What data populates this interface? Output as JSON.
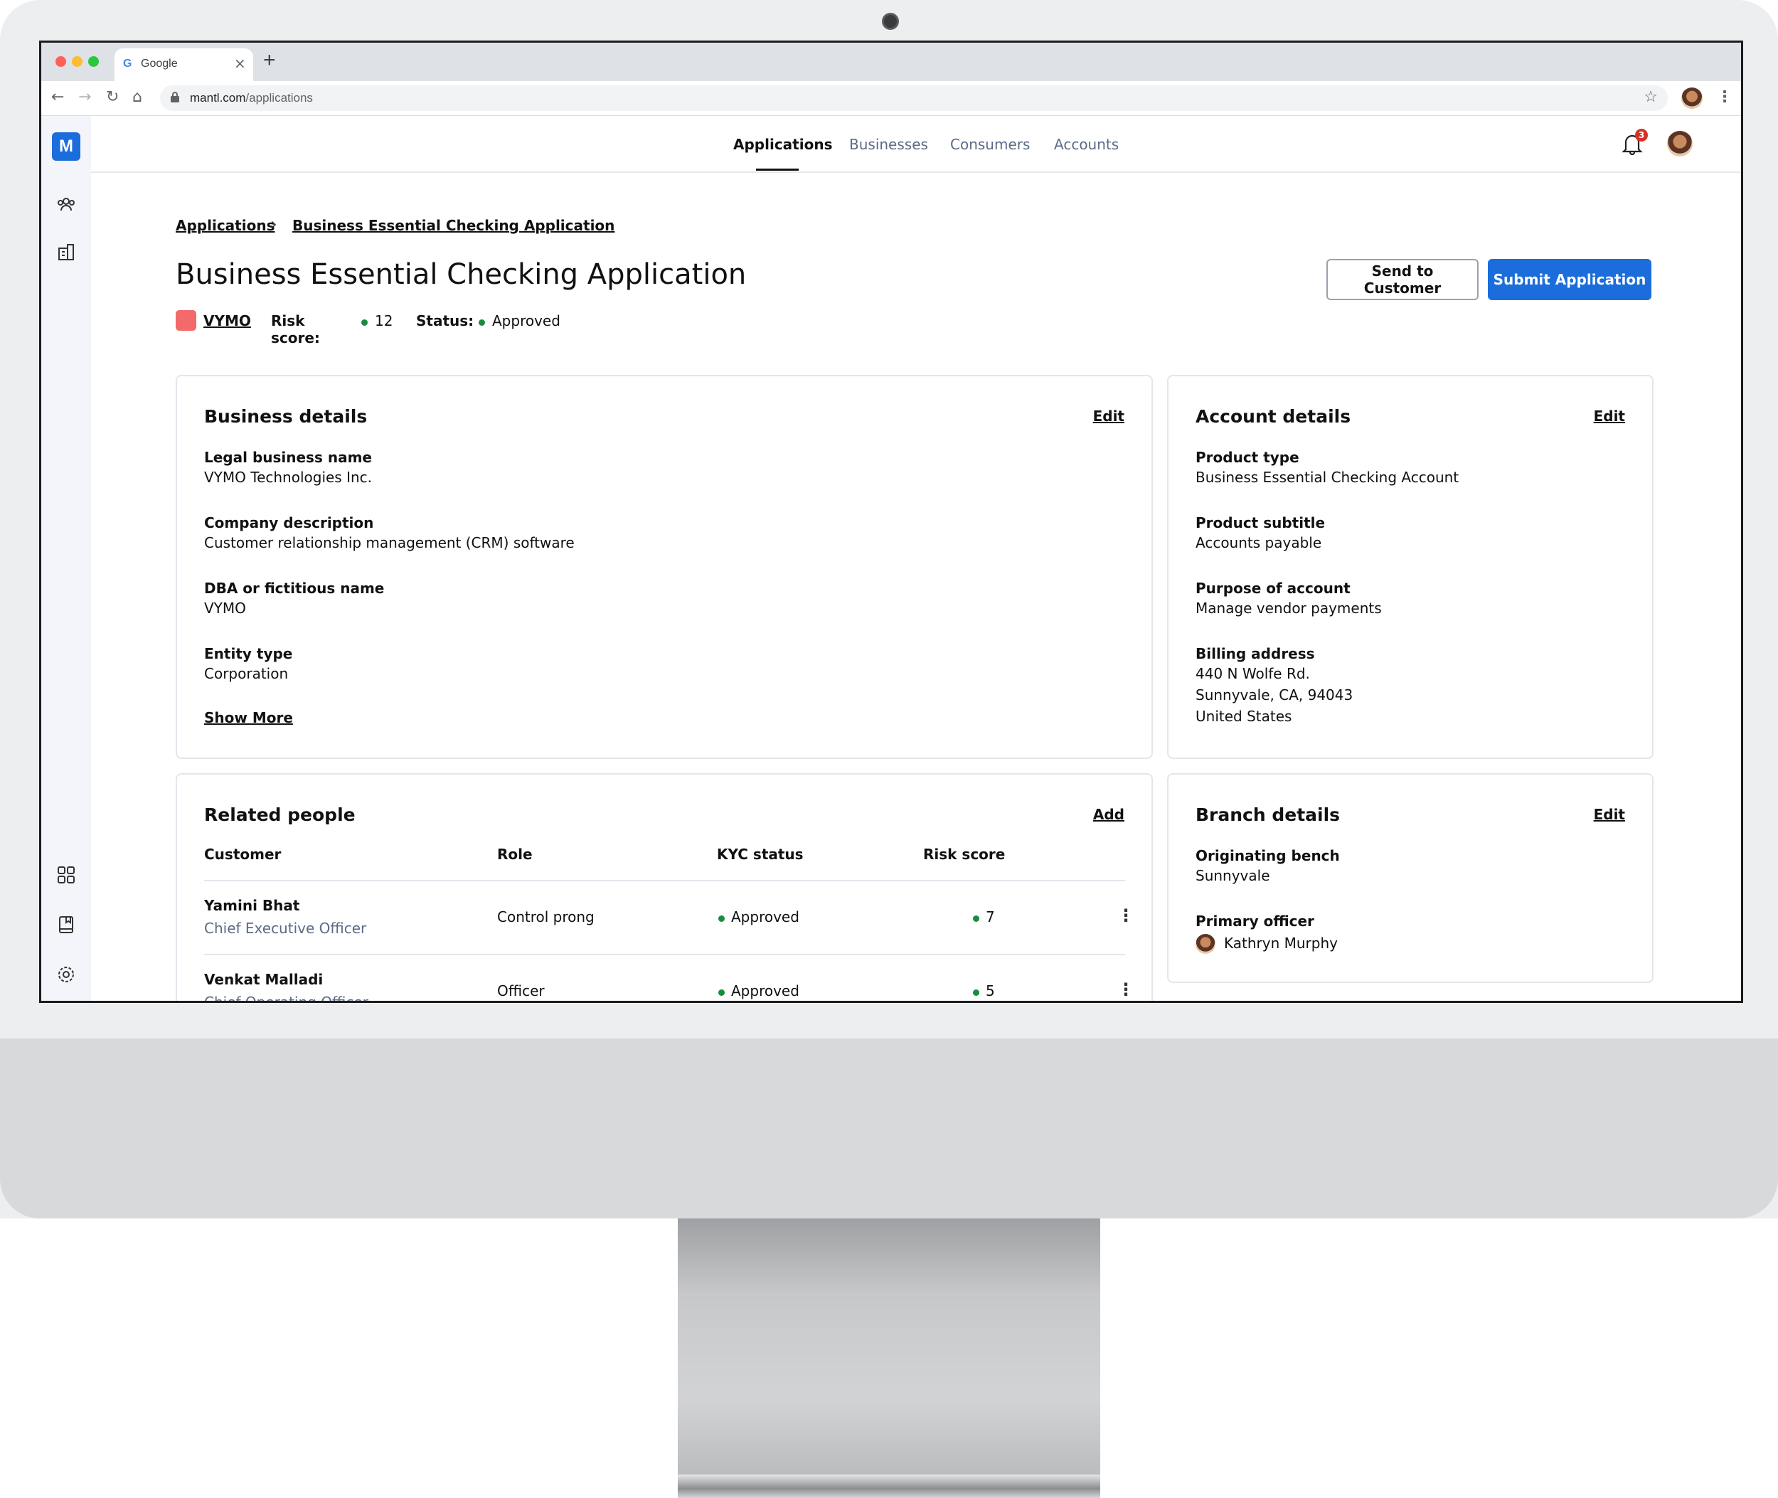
{
  "browser": {
    "tab_title": "Google",
    "tab_icon": "G",
    "url_host": "mantl.com",
    "url_path": "/applications"
  },
  "app": {
    "logo_letter": "M",
    "nav": [
      "Applications",
      "Businesses",
      "Consumers",
      "Accounts"
    ],
    "active_nav": "Applications",
    "notifications_count": "3"
  },
  "breadcrumb": {
    "root": "Applications",
    "current": "Business Essential Checking Application"
  },
  "page": {
    "title": "Business Essential Checking Application",
    "send_button": "Send to Customer",
    "submit_button": "Submit Application",
    "business_name": "VYMO",
    "risk_label": "Risk score:",
    "risk_value": "12",
    "status_label": "Status:",
    "status_value": "Approved",
    "status_color": "#1a8c3e",
    "accent_color": "#1a6ddb"
  },
  "business_details": {
    "title": "Business details",
    "edit": "Edit",
    "fields": [
      {
        "label": "Legal business name",
        "value": "VYMO Technologies Inc."
      },
      {
        "label": "Company description",
        "value": "Customer relationship management (CRM) software"
      },
      {
        "label": "DBA or fictitious name",
        "value": "VYMO"
      },
      {
        "label": "Entity type",
        "value": "Corporation"
      }
    ],
    "show_more": "Show More"
  },
  "account_details": {
    "title": "Account details",
    "edit": "Edit",
    "fields": [
      {
        "label": "Product type",
        "value": "Business Essential Checking Account"
      },
      {
        "label": "Product subtitle",
        "value": "Accounts payable"
      },
      {
        "label": "Purpose of account",
        "value": "Manage vendor payments"
      }
    ],
    "billing_label": "Billing address",
    "billing_lines": [
      "440 N Wolfe Rd.",
      "Sunnyvale, CA, 94043",
      "United States"
    ]
  },
  "related_people": {
    "title": "Related people",
    "add": "Add",
    "columns": [
      "Customer",
      "Role",
      "KYC status",
      "Risk score"
    ],
    "rows": [
      {
        "name": "Yamini Bhat",
        "title": "Chief Executive Officer",
        "role": "Control prong",
        "kyc": "Approved",
        "risk": "7"
      },
      {
        "name": "Venkat Malladi",
        "title": "Chief Operating Officer",
        "role": "Officer",
        "kyc": "Approved",
        "risk": "5"
      }
    ]
  },
  "branch_details": {
    "title": "Branch details",
    "edit": "Edit",
    "bench_label": "Originating bench",
    "bench_value": "Sunnyvale",
    "officer_label": "Primary officer",
    "officer_value": "Kathryn Murphy"
  }
}
